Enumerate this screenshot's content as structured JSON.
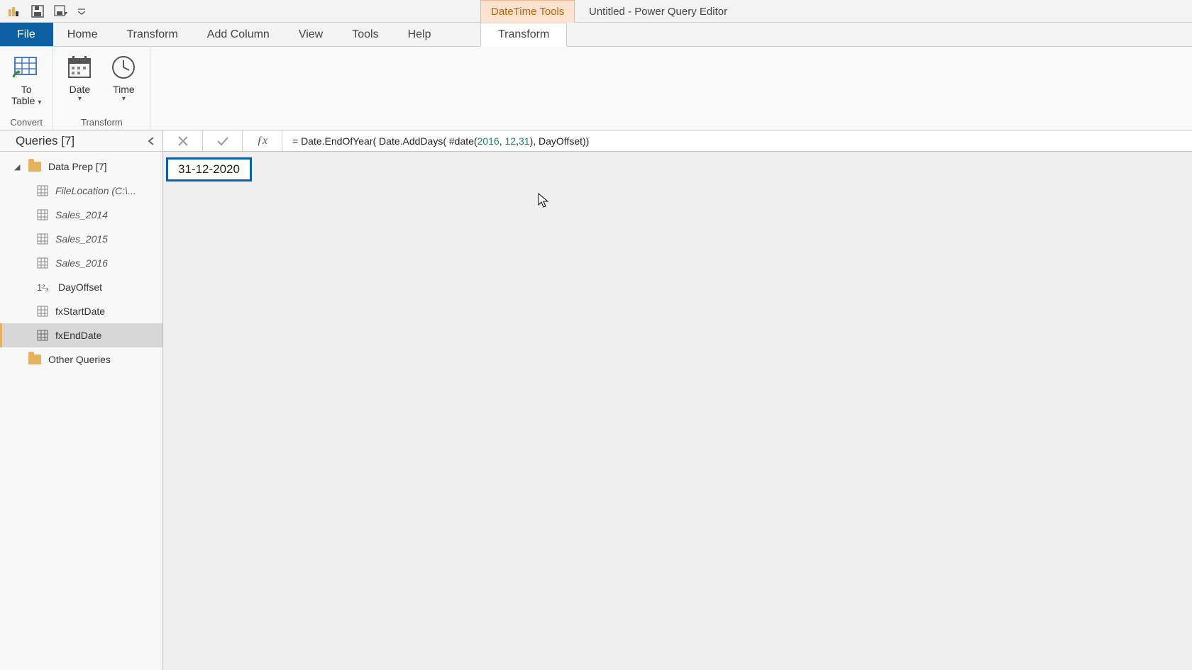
{
  "title_bar": {
    "tools_context_label": "DateTime Tools",
    "document_title": "Untitled - Power Query Editor"
  },
  "tabs": {
    "file": "File",
    "home": "Home",
    "transform": "Transform",
    "add_column": "Add Column",
    "view": "View",
    "tools": "Tools",
    "help": "Help",
    "context_transform": "Transform"
  },
  "ribbon": {
    "groups": {
      "convert": "Convert",
      "transform": "Transform"
    },
    "buttons": {
      "to_table": "To\nTable ",
      "date": "Date",
      "time": "Time"
    }
  },
  "queries_panel": {
    "title": "Queries [7]",
    "group_label": "Data Prep [7]",
    "items": [
      {
        "label": "FileLocation (C:\\...",
        "type": "table",
        "italic": true
      },
      {
        "label": "Sales_2014",
        "type": "table",
        "italic": true
      },
      {
        "label": "Sales_2015",
        "type": "table",
        "italic": true
      },
      {
        "label": "Sales_2016",
        "type": "table",
        "italic": true
      },
      {
        "label": "DayOffset",
        "type": "number",
        "italic": false
      },
      {
        "label": "fxStartDate",
        "type": "table",
        "italic": false
      },
      {
        "label": "fxEndDate",
        "type": "table",
        "italic": false,
        "selected": true
      }
    ],
    "other_group": "Other Queries"
  },
  "formula_bar": {
    "prefix": "= Date.EndOfYear( Date.AddDays( #date(",
    "n1": "2016",
    "sep1": ", ",
    "n2": "12",
    "sep2": ",",
    "n3": "31",
    "suffix": "), DayOffset))"
  },
  "result_value": "31-12-2020"
}
